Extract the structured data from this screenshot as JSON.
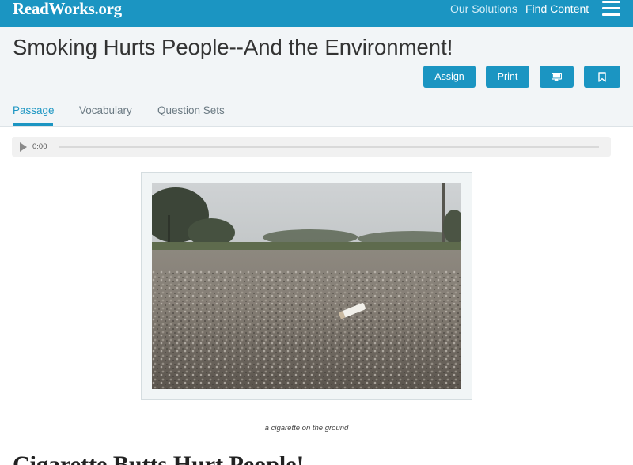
{
  "header": {
    "logo": "ReadWorks.org",
    "nav": {
      "our_solutions": "Our Solutions",
      "find_content": "Find Content"
    },
    "menu_icon": "hamburger-menu-icon"
  },
  "article": {
    "title": "Smoking Hurts People--And the Environment!",
    "actions": {
      "assign": "Assign",
      "print": "Print",
      "present_icon": "monitor-icon",
      "bookmark_icon": "bookmark-icon"
    },
    "tabs": [
      {
        "label": "Passage",
        "active": true
      },
      {
        "label": "Vocabulary",
        "active": false
      },
      {
        "label": "Question Sets",
        "active": false
      }
    ]
  },
  "audio": {
    "time": "0:00",
    "progress": 0
  },
  "photo": {
    "caption": "a cigarette on the ground"
  },
  "section": {
    "heading": "Cigarette Butts Hurt People!"
  },
  "colors": {
    "brand": "#1b95c2",
    "band": "#f2f5f7"
  }
}
